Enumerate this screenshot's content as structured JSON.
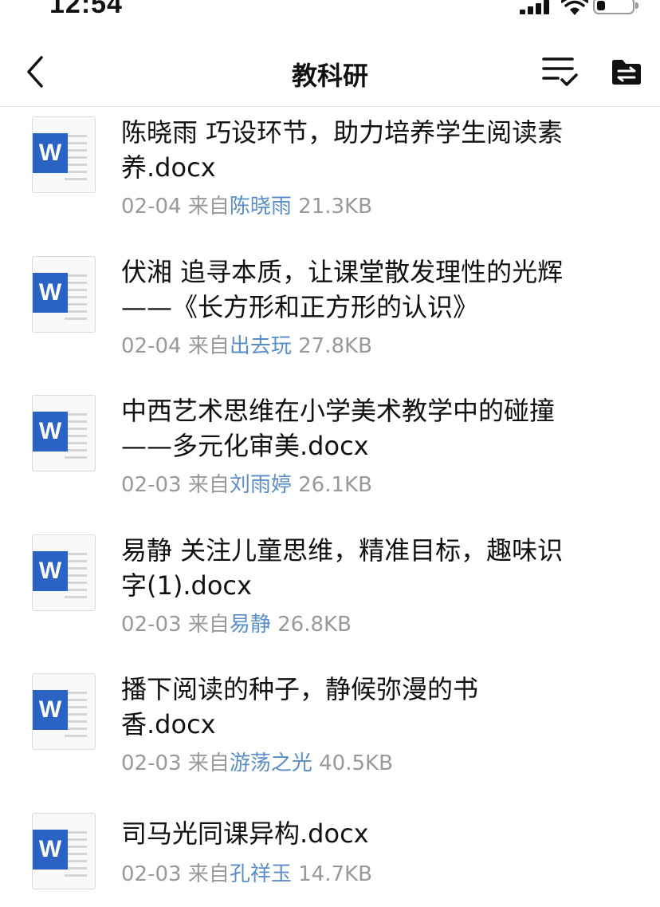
{
  "status_bar": {
    "time": "12:54"
  },
  "nav": {
    "title": "教科研"
  },
  "colors": {
    "accent_link": "#5b8dc9",
    "word_blue": "#2b63c4",
    "meta_gray": "#999999"
  },
  "files": [
    {
      "name": "陈晓雨 巧设环节，助力培养学生阅读素养.docx",
      "date": "02-04",
      "from": "来自",
      "sender": "陈晓雨",
      "size": "21.3KB",
      "icon": "word-doc-icon"
    },
    {
      "name": "伏湘 追寻本质，让课堂散发理性的光辉——《长方形和正方形的认识》",
      "date": "02-04",
      "from": "来自",
      "sender": "出去玩",
      "size": "27.8KB",
      "icon": "word-doc-icon"
    },
    {
      "name": "中西艺术思维在小学美术教学中的碰撞——多元化审美.docx",
      "date": "02-03",
      "from": "来自",
      "sender": "刘雨婷",
      "size": "26.1KB",
      "icon": "word-doc-icon"
    },
    {
      "name": "易静 关注儿童思维，精准目标，趣味识字(1).docx",
      "date": "02-03",
      "from": "来自",
      "sender": "易静",
      "size": "26.8KB",
      "icon": "word-doc-icon"
    },
    {
      "name": "播下阅读的种子，静候弥漫的书香.docx",
      "date": "02-03",
      "from": "来自",
      "sender": "游荡之光",
      "size": "40.5KB",
      "icon": "word-doc-icon"
    },
    {
      "name": "司马光同课异构.docx",
      "date": "02-03",
      "from": "来自",
      "sender": "孔祥玉",
      "size": "14.7KB",
      "icon": "word-doc-icon"
    }
  ]
}
